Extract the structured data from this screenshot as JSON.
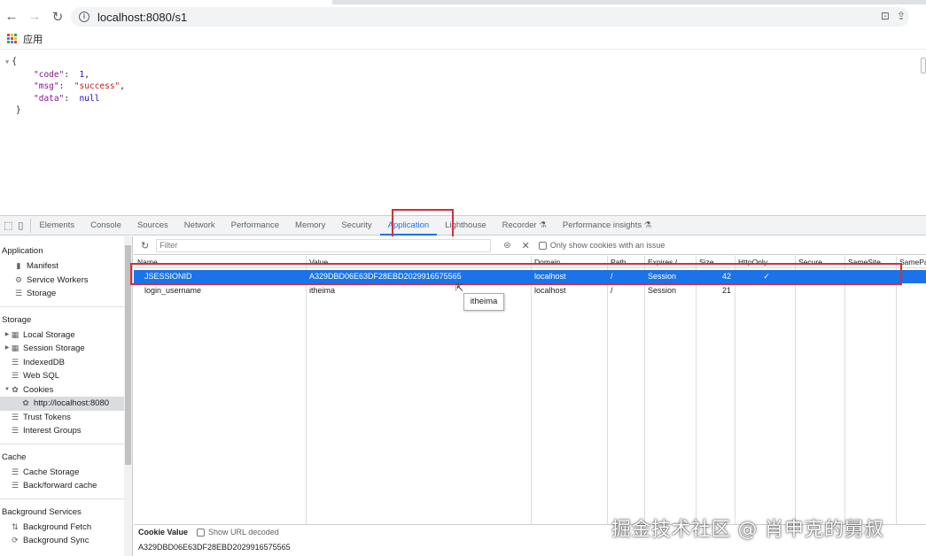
{
  "browser": {
    "url": "localhost:8080/s1",
    "bookmarks_label": "应用",
    "apps_colors": [
      "#ea4335",
      "#fbbc05",
      "#34a853",
      "#4285f4",
      "#ea4335",
      "#fbbc05",
      "#34a853",
      "#4285f4",
      "#ea4335"
    ]
  },
  "page": {
    "lines": [
      {
        "toggle": "▼",
        "text": "{"
      },
      {
        "key": "\"code\"",
        "sep": ":  ",
        "val": "1",
        "valtype": "num",
        "tail": ","
      },
      {
        "key": "\"msg\"",
        "sep": ":  ",
        "val": "\"success\"",
        "valtype": "str",
        "tail": ","
      },
      {
        "key": "\"data\"",
        "sep": ":  ",
        "val": "null",
        "valtype": "nul",
        "tail": ""
      },
      {
        "text": "}"
      }
    ]
  },
  "devtools": {
    "tabs": [
      "Elements",
      "Console",
      "Sources",
      "Network",
      "Performance",
      "Memory",
      "Security",
      "Application",
      "Lighthouse",
      "Recorder ⚗",
      "Performance insights ⚗"
    ],
    "active_tab": "Application",
    "sidebar": {
      "application_title": "Application",
      "application_items": [
        "Manifest",
        "Service Workers",
        "Storage"
      ],
      "storage_title": "Storage",
      "storage_items": [
        "Local Storage",
        "Session Storage",
        "IndexedDB",
        "Web SQL",
        "Cookies",
        "http://localhost:8080",
        "Trust Tokens",
        "Interest Groups"
      ],
      "cache_title": "Cache",
      "cache_items": [
        "Cache Storage",
        "Back/forward cache"
      ],
      "bg_title": "Background Services",
      "bg_items": [
        "Background Fetch",
        "Background Sync"
      ]
    },
    "filter": {
      "placeholder": "Filter",
      "only_issues_label": "Only show cookies with an issue"
    },
    "columns": [
      "Name",
      "Value",
      "Domain",
      "Path",
      "Expires /...",
      "Size",
      "HttpOnly",
      "Secure",
      "SameSite",
      "SameParty"
    ],
    "rows": [
      {
        "name": "JSESSIONID",
        "value": "A329DBD06E63DF28EBD2029916575565",
        "domain": "localhost",
        "path": "/",
        "expires": "Session",
        "size": "42",
        "httponly": "✓",
        "selected": true
      },
      {
        "name": "login_username",
        "value": "itheima",
        "domain": "localhost",
        "path": "/",
        "expires": "Session",
        "size": "21",
        "httponly": "",
        "selected": false
      }
    ],
    "tooltip": "itheima",
    "cookie_value": {
      "title": "Cookie Value",
      "show_decoded_label": "Show URL decoded",
      "value": "A329DBD06E63DF28EBD2029916575565"
    }
  },
  "watermark": "掘金技术社区 @ 肖申克的舅叔",
  "colors": {
    "accent": "#1a73e8",
    "highlight_box": "#d32f3a"
  }
}
